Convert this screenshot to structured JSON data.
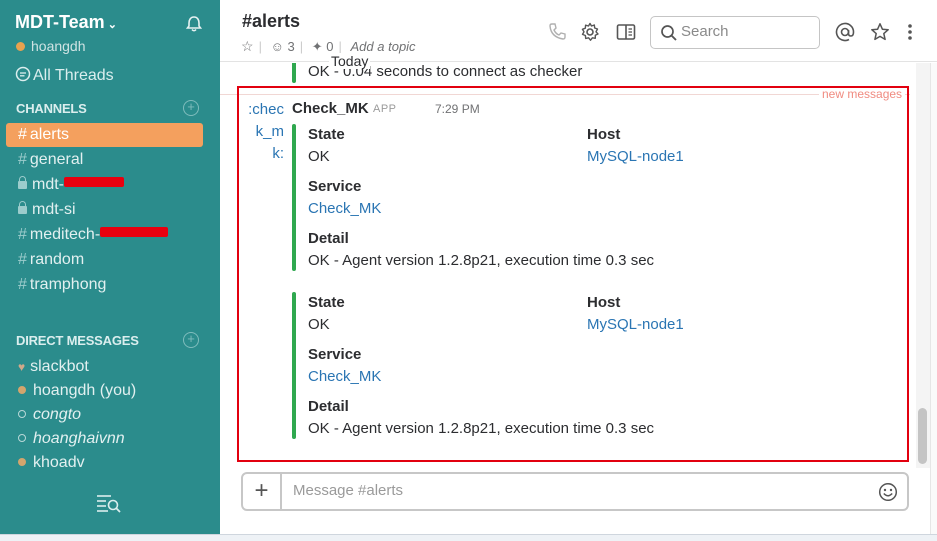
{
  "sidebar": {
    "team_name": "MDT-Team",
    "username": "hoangdh",
    "all_threads": "All Threads",
    "channels_header": "CHANNELS",
    "channels": [
      {
        "name": "alerts",
        "type": "public",
        "active": true
      },
      {
        "name": "general",
        "type": "public"
      },
      {
        "name": "mdt-",
        "type": "private",
        "redacted": true
      },
      {
        "name": "mdt-si",
        "type": "private"
      },
      {
        "name": "meditech-",
        "type": "public",
        "redacted": true
      },
      {
        "name": "random",
        "type": "public"
      },
      {
        "name": "tramphong",
        "type": "public"
      }
    ],
    "dm_header": "DIRECT MESSAGES",
    "direct_messages": [
      {
        "name": "slackbot",
        "status": "bot"
      },
      {
        "name": "hoangdh (you)",
        "status": "online"
      },
      {
        "name": "congto",
        "status": "offline"
      },
      {
        "name": "hoanghaivnn",
        "status": "offline"
      },
      {
        "name": "khoadv",
        "status": "online"
      }
    ],
    "colors": {
      "background": "#2b8c8c",
      "active": "#f4a05e"
    }
  },
  "header": {
    "channel": "#alerts",
    "members": "3",
    "pins": "0",
    "topic_placeholder": "Add a topic",
    "search_placeholder": "Search",
    "icons": [
      "phone-icon",
      "gear-icon",
      "sidebar-toggle-icon",
      "search-icon",
      "at-icon",
      "star-icon",
      "more-vertical-icon"
    ]
  },
  "messages": {
    "day_divider": "Today",
    "previous_text": "OK - 0.04 seconds to connect as checker",
    "new_messages_label": "new messages",
    "avatar_text": ":check_mk:",
    "sender": "Check_MK",
    "badge": "APP",
    "time": "7:29 PM",
    "attachments": [
      {
        "state_label": "State",
        "state": "OK",
        "host_label": "Host",
        "host": "MySQL-node1",
        "service_label": "Service",
        "service": "Check_MK",
        "detail_label": "Detail",
        "detail": "OK - Agent version 1.2.8p21, execution time 0.3 sec"
      },
      {
        "state_label": "State",
        "state": "OK",
        "host_label": "Host",
        "host": "MySQL-node1",
        "service_label": "Service",
        "service": "Check_MK",
        "detail_label": "Detail",
        "detail": "OK - Agent version 1.2.8p21, execution time 0.3 sec"
      }
    ]
  },
  "composer": {
    "placeholder": "Message #alerts",
    "plus_label": "+"
  }
}
